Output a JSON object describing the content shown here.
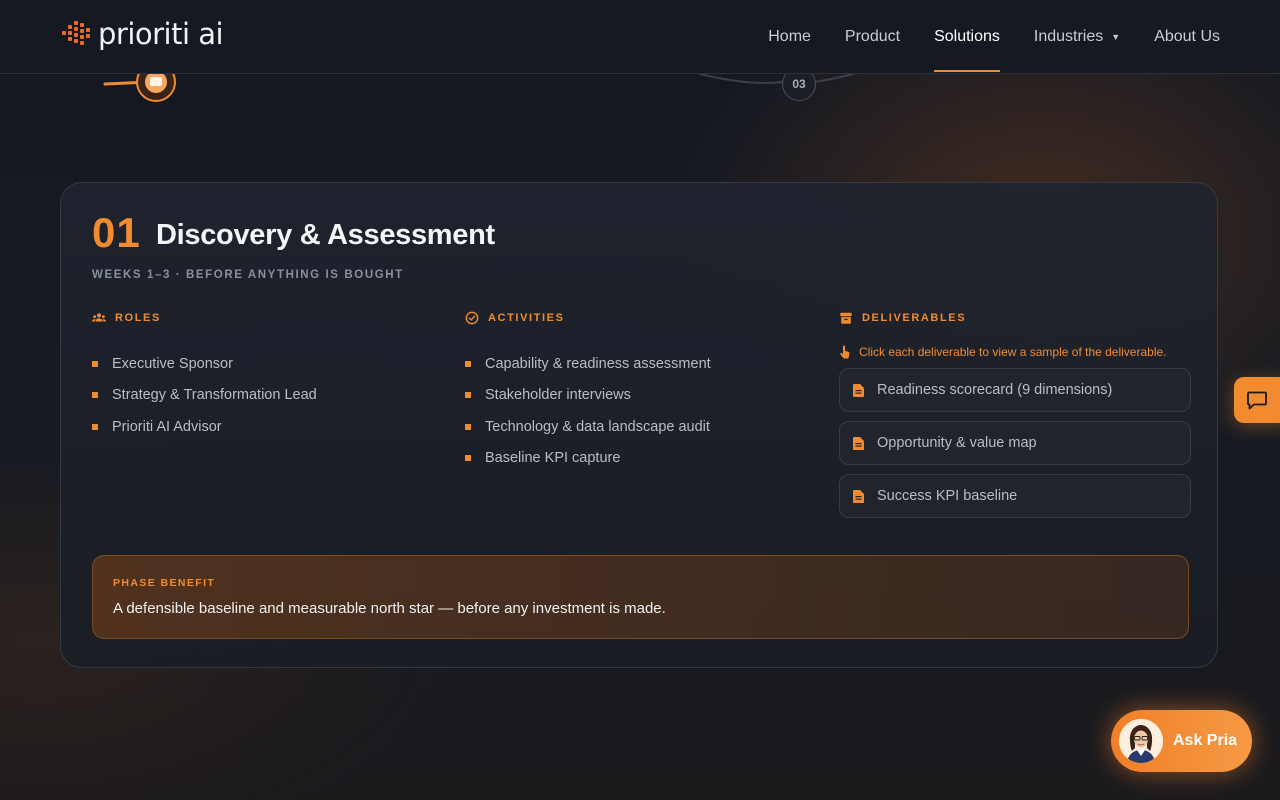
{
  "brand": {
    "name": "prioriti ai"
  },
  "nav": {
    "items": [
      {
        "label": "Home"
      },
      {
        "label": "Product"
      },
      {
        "label": "Solutions"
      },
      {
        "label": "Industries",
        "has_dropdown": true
      },
      {
        "label": "About Us"
      }
    ],
    "active": "Solutions"
  },
  "steps": {
    "visible_label": "03"
  },
  "phase": {
    "number": "01",
    "title": "Discovery & Assessment",
    "subtitle": "WEEKS 1–3 · BEFORE ANYTHING IS BOUGHT",
    "roles": {
      "label": "ROLES",
      "items": [
        "Executive Sponsor",
        "Strategy & Transformation Lead",
        "Prioriti AI Advisor"
      ]
    },
    "activities": {
      "label": "ACTIVITIES",
      "items": [
        "Capability & readiness assessment",
        "Stakeholder interviews",
        "Technology & data landscape audit",
        "Baseline KPI capture"
      ]
    },
    "deliverables": {
      "label": "DELIVERABLES",
      "hint": "Click each deliverable to view a sample of the deliverable.",
      "items": [
        "Readiness scorecard (9 dimensions)",
        "Opportunity & value map",
        "Success KPI baseline"
      ]
    },
    "benefit": {
      "label": "PHASE BENEFIT",
      "text": "A defensible baseline and measurable north star — before any investment is made."
    }
  },
  "assistant": {
    "label": "Ask Pria"
  },
  "colors": {
    "accent": "#f28b30",
    "background": "#161a22"
  },
  "icons": [
    "users-icon",
    "check-circle-icon",
    "archive-box-icon",
    "pointer-hand-icon",
    "document-icon",
    "chat-icon"
  ]
}
